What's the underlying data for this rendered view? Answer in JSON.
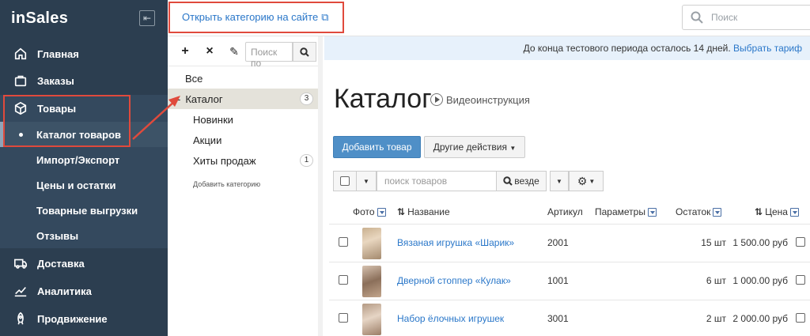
{
  "sidebar": {
    "logo": "inSales",
    "collapse_icon": "collapse-left-icon",
    "items": [
      {
        "label": "Главная",
        "icon": "home-icon"
      },
      {
        "label": "Заказы",
        "icon": "bag-icon"
      },
      {
        "label": "Товары",
        "icon": "box-icon"
      },
      {
        "label": "Доставка",
        "icon": "truck-icon"
      },
      {
        "label": "Аналитика",
        "icon": "chart-icon"
      },
      {
        "label": "Продвижение",
        "icon": "rocket-icon"
      }
    ],
    "sub_items": [
      {
        "label": "Каталог товаров"
      },
      {
        "label": "Импорт/Экспорт"
      },
      {
        "label": "Цены и остатки"
      },
      {
        "label": "Товарные выгрузки"
      },
      {
        "label": "Отзывы"
      }
    ]
  },
  "topbar": {
    "open_link": "Открыть категорию на сайте",
    "search_placeholder": "Поиск"
  },
  "categories": {
    "search_placeholder": "Поиск по",
    "items": [
      {
        "label": "Все",
        "badge": ""
      },
      {
        "label": "Каталог",
        "badge": "3",
        "prefix": "-"
      },
      {
        "label": "Новинки",
        "badge": ""
      },
      {
        "label": "Акции",
        "badge": ""
      },
      {
        "label": "Хиты продаж",
        "badge": "1"
      }
    ],
    "add_label": "Добавить категорию"
  },
  "trial": {
    "text": "До конца тестового периода осталось 14 дней.",
    "link": "Выбрать тариф"
  },
  "main": {
    "title": "Каталог",
    "video_link": "Видеоинструкция",
    "add_button": "Добавить товар",
    "other_actions": "Другие действия",
    "search_placeholder": "поиск товаров",
    "scope": "везде"
  },
  "table": {
    "headers": {
      "photo": "Фото",
      "name": "Название",
      "sku": "Артикул",
      "params": "Параметры",
      "stock": "Остаток",
      "price": "Цена"
    },
    "rows": [
      {
        "name": "Вязаная игрушка «Шарик»",
        "sku": "2001",
        "stock": "15 шт",
        "price": "1 500.00 руб"
      },
      {
        "name": "Дверной стоппер «Кулак»",
        "sku": "1001",
        "stock": "6 шт",
        "price": "1 000.00 руб"
      },
      {
        "name": "Набор ёлочных игрушек",
        "sku": "3001",
        "stock": "2 шт",
        "price": "2 000.00 руб"
      }
    ]
  },
  "colors": {
    "sidebar_bg": "#2c3e50",
    "accent": "#2a77c9",
    "highlight": "#e04a3c",
    "primary_button": "#4f8fc7"
  }
}
